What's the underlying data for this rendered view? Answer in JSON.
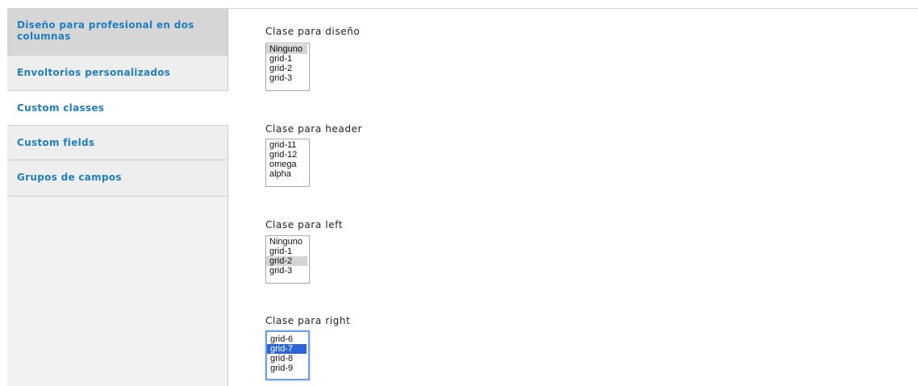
{
  "tabs": [
    {
      "label": "Diseño para profesional en dos columnas",
      "state": "active-gray"
    },
    {
      "label": "Envoltorios personalizados"
    },
    {
      "label": "Custom classes",
      "state": "selected"
    },
    {
      "label": "Custom fields"
    },
    {
      "label": "Grupos de campos"
    }
  ],
  "fields": {
    "diseno": {
      "label": "Clase para diseño",
      "options": [
        "Ninguno",
        "grid-1",
        "grid-2",
        "grid-3"
      ],
      "selected": "Ninguno"
    },
    "header": {
      "label": "Clase para header",
      "options": [
        "grid-11",
        "grid-12",
        "omega",
        "alpha"
      ]
    },
    "left": {
      "label": "Clase para left",
      "options": [
        "Ninguno",
        "grid-1",
        "grid-2",
        "grid-3"
      ],
      "selected": "grid-2"
    },
    "right": {
      "label": "Clase para right",
      "options": [
        "grid-6",
        "grid-7",
        "grid-8",
        "grid-9"
      ],
      "selected": "grid-7"
    }
  },
  "colors": {
    "link": "#1f7fc2",
    "selection_blue": "#2a64d8",
    "focus_ring": "#6a9ee6"
  }
}
